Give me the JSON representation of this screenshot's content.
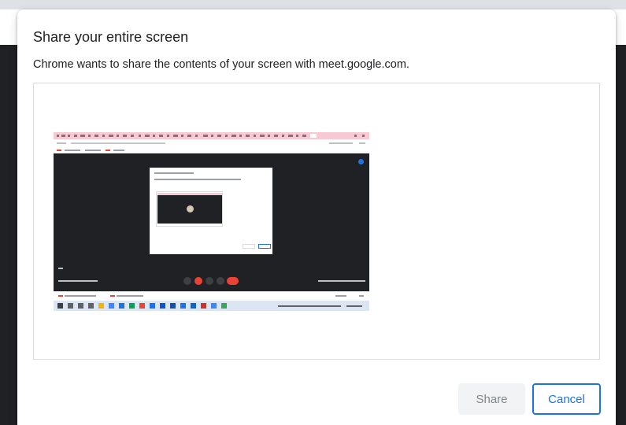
{
  "dialog": {
    "title": "Share your entire screen",
    "subtitle": "Chrome wants to share the contents of your screen with meet.google.com.",
    "share_label": "Share",
    "cancel_label": "Cancel"
  },
  "colors": {
    "accent": "#1a73e8",
    "backdrop": "#202124",
    "share_disabled_bg": "#f1f3f4",
    "end_call_red": "#ea4335"
  }
}
